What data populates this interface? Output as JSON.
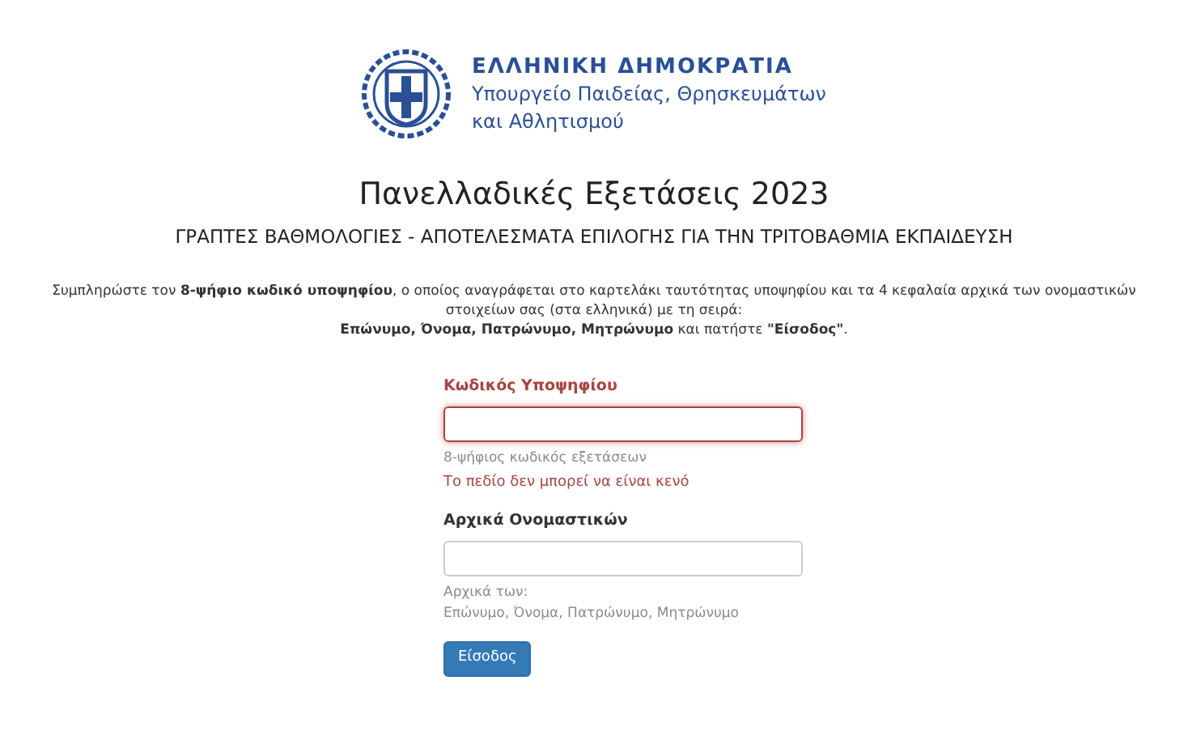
{
  "header": {
    "title": "ΕΛΛΗΝΙΚΗ ΔΗΜΟΚΡΑΤΙΑ",
    "subtitle_lines": [
      "Υπουργείο Παιδείας, Θρησκευμάτων",
      "και Αθλητισμού"
    ]
  },
  "page_title": "Πανελλαδικές Εξετάσεις 2023",
  "page_subtitle": "ΓΡΑΠΤΕΣ ΒΑΘΜΟΛΟΓΙΕΣ - ΑΠΟΤΕΛΕΣΜΑΤΑ ΕΠΙΛΟΓΗΣ ΓΙΑ ΤΗΝ ΤΡΙΤΟΒΑΘΜΙΑ ΕΚΠΑΙΔΕΥΣΗ",
  "instructions": [
    "Συμπληρώστε τον **8-ψήφιο κωδικό υποψηφίου**, ο οποίος αναγράφεται στο καρτελάκι ταυτότητας υποψηφίου και τα 4 κεφαλαία αρχικά των ονομαστικών στοιχείων σας (στα ελληνικά) με τη σειρά:",
    "**Επώνυμο, Όνομα, Πατρώνυμο, Μητρώνυμο** και πατήστε **\"Είσοδος\"**."
  ],
  "fields": [
    {
      "label": "Κωδικός Υποψηφίου",
      "error": true,
      "help_lines": [
        "8-ψήφιος κωδικός εξετάσεων"
      ],
      "error_message": "Το πεδίο δεν μπορεί να είναι κενό"
    },
    {
      "label": "Αρχικά Ονομαστικών",
      "error": false,
      "help_lines": [
        "Αρχικά των:",
        "Επώνυμο, Όνομα, Πατρώνυμο, Μητρώνυμο"
      ]
    }
  ],
  "submit_button": "Είσοδος"
}
